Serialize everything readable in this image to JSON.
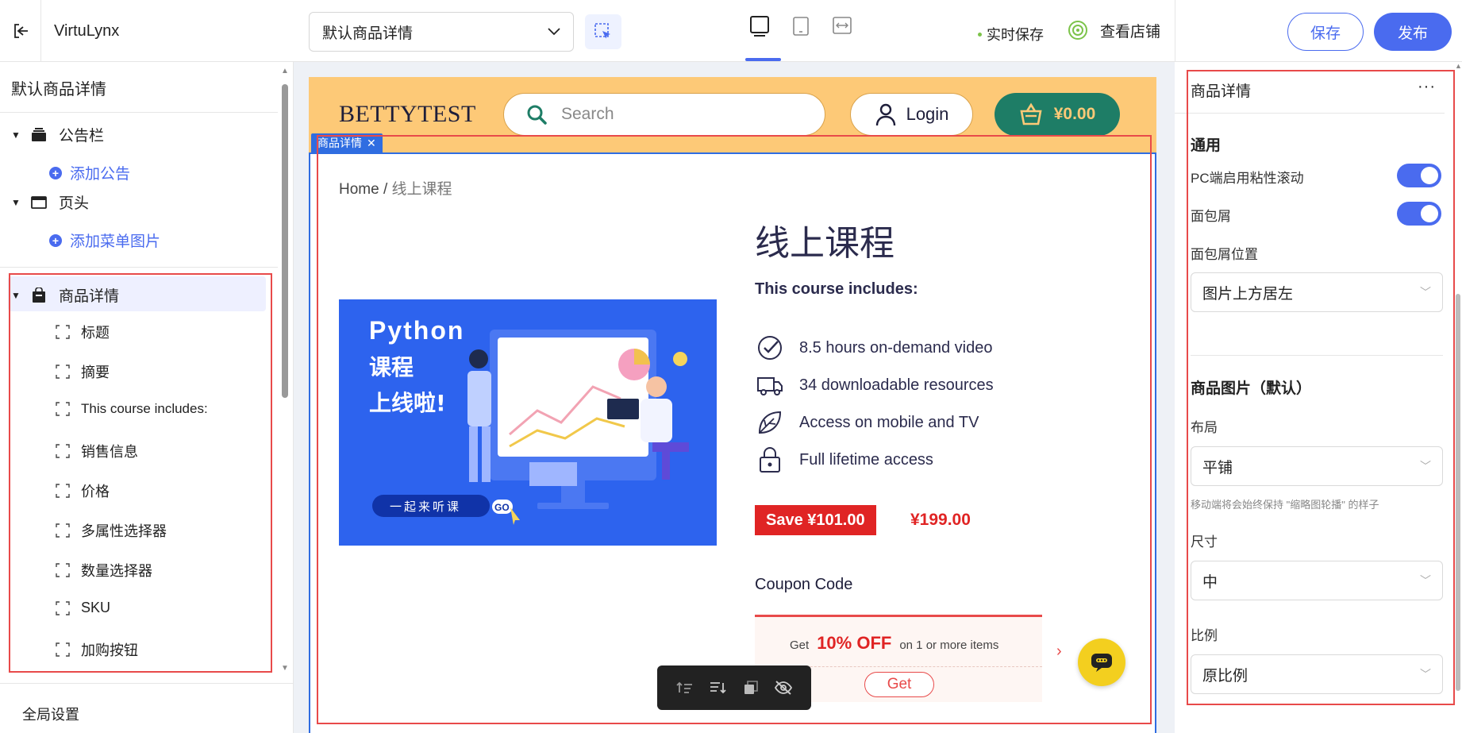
{
  "topbar": {
    "app_name": "VirtuLynx",
    "template_select_value": "默认商品详情",
    "autosave_label": "实时保存",
    "view_store_label": "查看店铺",
    "save_label": "保存",
    "publish_label": "发布",
    "accent_color": "#4a6bef"
  },
  "left_panel": {
    "title": "默认商品详情",
    "groups": [
      {
        "label": "公告栏",
        "add_label": "添加公告",
        "icon": "stack-icon"
      },
      {
        "label": "页头",
        "add_label": "添加菜单图片",
        "icon": "window-icon"
      },
      {
        "label": "商品详情",
        "icon": "bag-icon"
      }
    ],
    "children": [
      {
        "label": "标题"
      },
      {
        "label": "摘要"
      },
      {
        "label": "This course includes:"
      },
      {
        "label": "销售信息"
      },
      {
        "label": "价格"
      },
      {
        "label": "多属性选择器"
      },
      {
        "label": "数量选择器"
      },
      {
        "label": "SKU"
      },
      {
        "label": "加购按钮"
      }
    ],
    "global_settings_label": "全局设置"
  },
  "preview": {
    "logo": "BETTYTEST",
    "search_placeholder": "Search",
    "login_label": "Login",
    "cart_total": "¥0.00",
    "section_tag": "商品详情",
    "breadcrumb_home": "Home",
    "breadcrumb_sep": " / ",
    "breadcrumb_current": "线上课程",
    "product_title": "线上课程",
    "includes_title": "This course includes:",
    "features": [
      {
        "text": "8.5 hours on-demand video",
        "icon": "check-circle-icon"
      },
      {
        "text": "34 downloadable resources",
        "icon": "truck-icon"
      },
      {
        "text": "Access on mobile and TV",
        "icon": "leaf-icon"
      },
      {
        "text": "Full lifetime access",
        "icon": "lock-icon"
      }
    ],
    "save_badge": "Save ¥101.00",
    "price": "¥199.00",
    "coupon_label": "Coupon Code",
    "coupon_get_prefix": "Get",
    "coupon_off": "10% OFF",
    "coupon_suffix": "on 1 or more items",
    "coupon_get_button": "Get",
    "image": {
      "line1": "Python",
      "line2": "课程",
      "line3": "上线啦!",
      "pill": "一起来听课",
      "go": "GO"
    },
    "header_color": "#fdc977",
    "cart_color": "#1e7d66"
  },
  "right_panel": {
    "title": "商品详情",
    "more": "···",
    "section_general": "通用",
    "sticky_label": "PC端启用粘性滚动",
    "sticky_on": true,
    "breadcrumb_label": "面包屑",
    "breadcrumb_on": true,
    "breadcrumb_pos_label": "面包屑位置",
    "breadcrumb_pos_value": "图片上方居左",
    "section_images": "商品图片（默认）",
    "layout_label": "布局",
    "layout_value": "平铺",
    "layout_note": "移动端将会始终保持 \"缩略图轮播\" 的样子",
    "size_label": "尺寸",
    "size_value": "中",
    "ratio_label": "比例",
    "ratio_value": "原比例"
  }
}
